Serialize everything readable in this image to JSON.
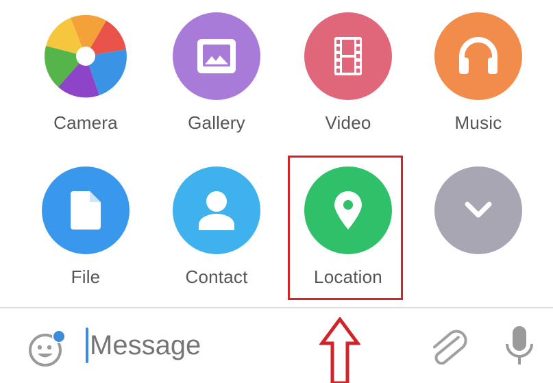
{
  "attach_menu": {
    "items": [
      {
        "label": "Camera",
        "icon": "camera-shutter-icon"
      },
      {
        "label": "Gallery",
        "icon": "image-icon",
        "color": "#a97bd8"
      },
      {
        "label": "Video",
        "icon": "film-strip-icon",
        "color": "#e0677a"
      },
      {
        "label": "Music",
        "icon": "headphones-icon",
        "color": "#f18c4a"
      },
      {
        "label": "File",
        "icon": "file-icon",
        "color": "#3a98ec"
      },
      {
        "label": "Contact",
        "icon": "person-icon",
        "color": "#3fb2ee"
      },
      {
        "label": "Location",
        "icon": "map-pin-icon",
        "color": "#30c069"
      },
      {
        "label": "",
        "icon": "chevron-down-icon",
        "color": "#a9a6b4"
      }
    ],
    "highlight_color": "#d2232a"
  },
  "input_bar": {
    "placeholder": "Message",
    "emoji_icon": "emoji-icon",
    "attach_icon": "paperclip-icon",
    "mic_icon": "microphone-icon",
    "accent": "#3d8bd9"
  }
}
